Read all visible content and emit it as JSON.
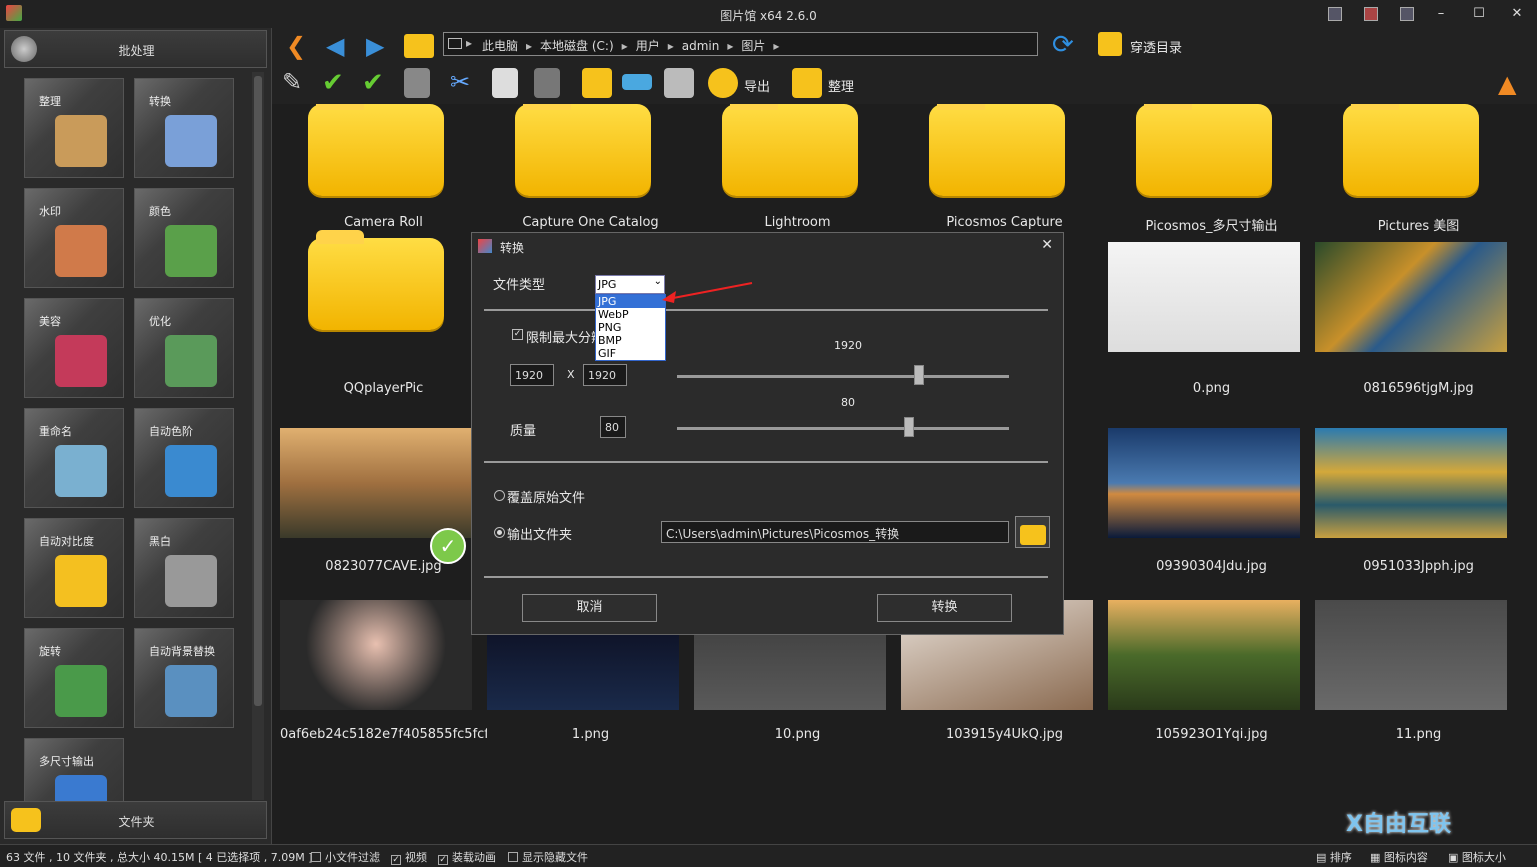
{
  "window": {
    "title": "图片馆 x64 2.6.0"
  },
  "left_panel": {
    "batch_label": "批处理",
    "folder_label": "文件夹",
    "tiles": [
      {
        "label": "整理",
        "icon": "organize-icon"
      },
      {
        "label": "转换",
        "icon": "convert-icon"
      },
      {
        "label": "水印",
        "icon": "watermark-icon"
      },
      {
        "label": "颜色",
        "icon": "color-icon"
      },
      {
        "label": "美容",
        "icon": "beauty-icon"
      },
      {
        "label": "优化",
        "icon": "optimize-icon"
      },
      {
        "label": "重命名",
        "icon": "rename-icon"
      },
      {
        "label": "自动色阶",
        "icon": "auto-levels-icon"
      },
      {
        "label": "自动对比度",
        "icon": "auto-contrast-icon"
      },
      {
        "label": "黑白",
        "icon": "black-white-icon"
      },
      {
        "label": "旋转",
        "icon": "rotate-icon"
      },
      {
        "label": "自动背景替换",
        "icon": "background-replace-icon"
      },
      {
        "label": "多尺寸输出",
        "icon": "multi-size-icon"
      }
    ]
  },
  "nav": {
    "breadcrumb": [
      "此电脑",
      "本地磁盘 (C:)",
      "用户",
      "admin",
      "图片"
    ],
    "penetrate_label": "穿透目录"
  },
  "toolbar": {
    "export_label": "导出",
    "organize_label": "整理"
  },
  "grid": {
    "items": [
      {
        "name": "Camera Roll",
        "kind": "folder"
      },
      {
        "name": "Capture One Catalog",
        "kind": "folder"
      },
      {
        "name": "Lightroom",
        "kind": "folder"
      },
      {
        "name": "Picosmos Capture",
        "kind": "folder"
      },
      {
        "name": "Picosmos_多尺寸输出",
        "kind": "folder"
      },
      {
        "name": "Pictures 美图",
        "kind": "folder"
      },
      {
        "name": "QQplayerPic",
        "kind": "folder"
      },
      {
        "name": "0.png",
        "kind": "image"
      },
      {
        "name": "0816596tjgM.jpg",
        "kind": "image"
      },
      {
        "name": "0823077CAVE.jpg",
        "kind": "image"
      },
      {
        "name": "09390304Jdu.jpg",
        "kind": "image"
      },
      {
        "name": "0951033Jpph.jpg",
        "kind": "image"
      },
      {
        "name": "0af6eb24c5182e7f405855fc5fcf...",
        "kind": "image"
      },
      {
        "name": "1.png",
        "kind": "image"
      },
      {
        "name": "10.png",
        "kind": "image"
      },
      {
        "name": "103915y4UkQ.jpg",
        "kind": "image"
      },
      {
        "name": "105923O1Yqi.jpg",
        "kind": "image"
      },
      {
        "name": "11.png",
        "kind": "image"
      }
    ]
  },
  "dialog": {
    "title": "转换",
    "file_type_label": "文件类型",
    "file_type_selected": "JPG",
    "file_type_options": [
      "JPG",
      "WebP",
      "PNG",
      "BMP",
      "GIF"
    ],
    "limit_label": "限制最大分辨",
    "limit_checked": true,
    "width_value": "1920",
    "height_value": "1920",
    "x_sep": "X",
    "size_slider_value": "1920",
    "size_slider_level": 0.73,
    "quality_label": "质量",
    "quality_value": "80",
    "quality_slider_value": "80",
    "quality_slider_level": 0.7,
    "overwrite_label": "覆盖原始文件",
    "output_folder_label": "输出文件夹",
    "output_path": "C:\\Users\\admin\\Pictures\\Picosmos_转换",
    "cancel_label": "取消",
    "convert_label": "转换"
  },
  "status": {
    "summary": "63 文件 , 10 文件夹 , 总大小 40.15M [ 4 已选择项 , 7.09M ]",
    "small_file_filter": "小文件过滤",
    "video": "视频",
    "load_animation": "装载动画",
    "show_hidden": "显示隐藏文件",
    "sort": "排序",
    "icon_content": "图标内容",
    "icon_size": "图标大小"
  },
  "watermark": {
    "text": "X自由互联"
  },
  "colors": {
    "accent_orange": "#f08a24",
    "nav_blue": "#3a8fd8",
    "folder_yellow": "#f6c21c",
    "select_blue": "#3370d6"
  }
}
